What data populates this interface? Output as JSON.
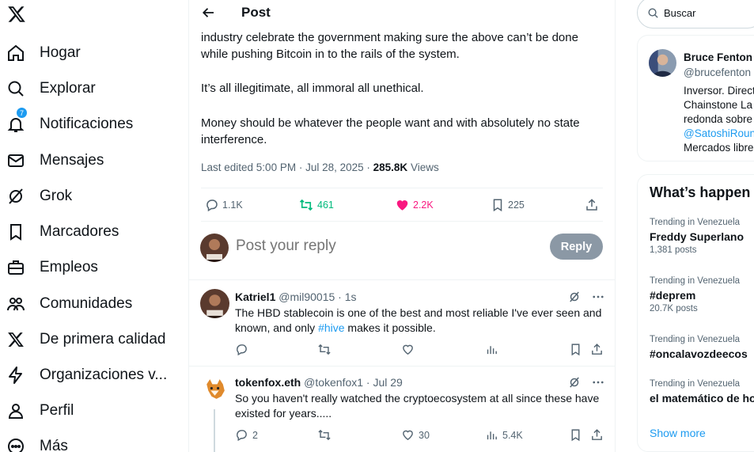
{
  "sidebar": {
    "items": [
      {
        "label": "Hogar",
        "icon": "home-icon"
      },
      {
        "label": "Explorar",
        "icon": "search-icon"
      },
      {
        "label": "Notificaciones",
        "icon": "bell-icon",
        "badge": "7"
      },
      {
        "label": "Mensajes",
        "icon": "envelope-icon"
      },
      {
        "label": "Grok",
        "icon": "grok-icon"
      },
      {
        "label": "Marcadores",
        "icon": "bookmark-icon"
      },
      {
        "label": "Empleos",
        "icon": "briefcase-icon"
      },
      {
        "label": "Comunidades",
        "icon": "communities-icon"
      },
      {
        "label": "De primera calidad",
        "icon": "x-logo-icon"
      },
      {
        "label": "Organizaciones v...",
        "icon": "lightning-icon"
      },
      {
        "label": "Perfil",
        "icon": "person-icon"
      },
      {
        "label": "Más",
        "icon": "more-circle-icon"
      }
    ]
  },
  "header": {
    "title": "Post"
  },
  "post": {
    "paragraphs": [
      "industry celebrate the government making sure the above can’t be done while pushing Bitcoin in to the rails of the system.",
      "It’s all illegitimate, all immoral all unethical.",
      "Money should be whatever the people want and with absolutely no state interference."
    ],
    "edited": "Last edited 5:00 PM · Jul 28, 2025 · ",
    "views": "285.8K",
    "views_label": " Views",
    "replies": "1.1K",
    "reposts": "461",
    "likes": "2.2K",
    "bookmarks": "225"
  },
  "reply_box": {
    "placeholder": "Post your reply",
    "button": "Reply"
  },
  "replies": [
    {
      "name": "Katriel1",
      "handle": "@mil90015",
      "time": " · 1s",
      "text_before": "The HBD stablecoin is one of the best and most reliable I've ever seen and known, and only ",
      "hashtag": "#hive",
      "text_after": " makes it possible.",
      "replies": "",
      "likes": "",
      "views": ""
    },
    {
      "name": "tokenfox.eth",
      "handle": "@tokenfox1",
      "time": " · Jul 29",
      "text": "So you haven't really watched the cryptoecosystem at all since these have existed for years.....",
      "replies": "2",
      "likes": "30",
      "views": "5.4K"
    }
  ],
  "search": {
    "placeholder": "Buscar"
  },
  "profile_card": {
    "name": "Bruce Fenton",
    "handle": "@brucefenton",
    "bio_lines": [
      "Inversor. Direct",
      "Chainstone La",
      "redonda sobre",
      "@SatoshiRoun",
      "Mercados libre"
    ]
  },
  "trends": {
    "title": "What’s happen",
    "items": [
      {
        "context": "Trending in Venezuela",
        "name": "Freddy Superlano",
        "count": "1,381 posts"
      },
      {
        "context": "Trending in Venezuela",
        "name": "#deprem",
        "count": "20.7K posts"
      },
      {
        "context": "Trending in Venezuela",
        "name": "#oncalavozdeecos",
        "count": ""
      },
      {
        "context": "Trending in Venezuela",
        "name": "el matemático de ho",
        "count": ""
      }
    ],
    "show_more": "Show more"
  },
  "colors": {
    "accent": "#1d9bf0",
    "repost_green": "#00ba7c",
    "like_pink": "#f91880",
    "muted": "#536471"
  }
}
